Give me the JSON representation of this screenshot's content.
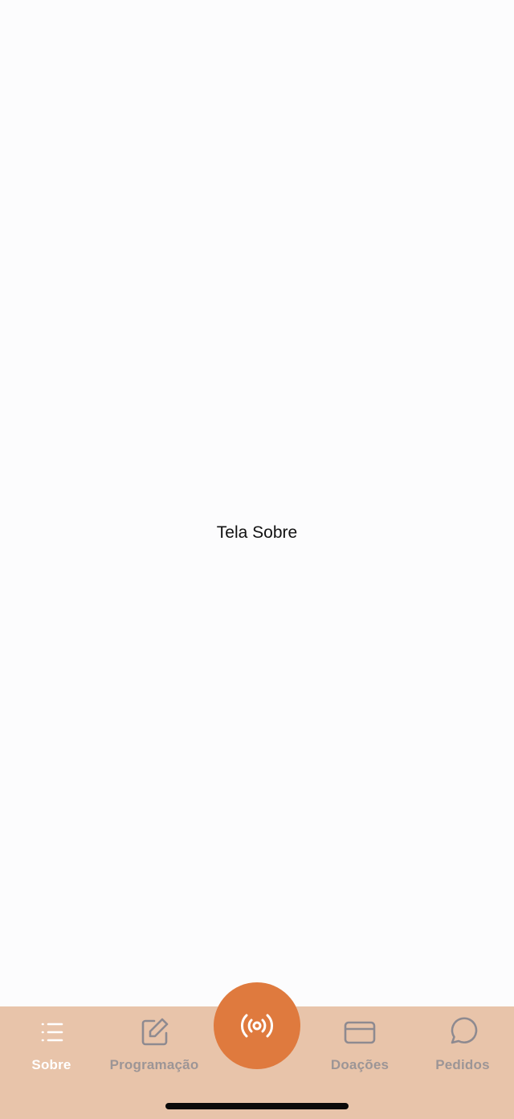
{
  "screen": {
    "title": "Tela Sobre"
  },
  "tabbar": {
    "background": "#e8c4aa",
    "active_color": "#ffffff",
    "inactive_color": "#9c9596",
    "tabs": [
      {
        "label": "Sobre",
        "icon": "list-icon",
        "active": true
      },
      {
        "label": "Programação",
        "icon": "edit-icon",
        "active": false
      },
      {
        "label": "Doações",
        "icon": "credit-card-icon",
        "active": false
      },
      {
        "label": "Pedidos",
        "icon": "message-circle-icon",
        "active": false
      }
    ],
    "center_button": {
      "icon": "radio-broadcast-icon",
      "color": "#df7a3e"
    }
  }
}
